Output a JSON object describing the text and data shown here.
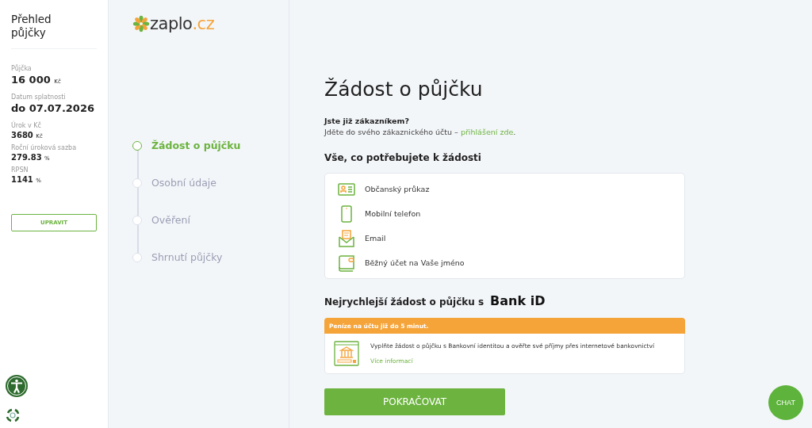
{
  "summary": {
    "title": "Přehled půjčky",
    "items": [
      {
        "kind": "large",
        "label": "Půjčka",
        "value": "16 000",
        "unit": "Kč"
      },
      {
        "kind": "large",
        "label": "Datum splatnosti",
        "value": "do 07.07.2026"
      },
      {
        "kind": "small",
        "label": "Úrok v Kč",
        "value": "3680",
        "unit": "Kč"
      },
      {
        "kind": "small",
        "label": "Roční úroková sazba",
        "value": "279.83",
        "unit": "%"
      },
      {
        "kind": "small",
        "label": "RPSN",
        "value": "1141",
        "unit": "%"
      }
    ],
    "edit_button": "UPRAVIT"
  },
  "logo": {
    "name": "zaplo",
    "domain": ".cz"
  },
  "steps": [
    {
      "label": "Žádost o půjčku",
      "selected": true
    },
    {
      "label": "Osobní údaje",
      "selected": false
    },
    {
      "label": "Ověření",
      "selected": false
    },
    {
      "label": "Shrnutí půjčky",
      "selected": false
    }
  ],
  "title": "Žádost o půjčku",
  "customer": {
    "question": "Jste již zákazníkem?",
    "text": "Jděte do svého zákaznického účtu – ",
    "link": "přihlášení zde",
    "after": "."
  },
  "requirements": {
    "heading": "Vše, co potřebujete k žádosti",
    "items": [
      {
        "kind": "id-card",
        "label": "Občanský průkaz"
      },
      {
        "kind": "phone",
        "label": "Mobilní telefon"
      },
      {
        "kind": "email",
        "label": "Email"
      },
      {
        "kind": "wallet",
        "label": "Běžný účet na Vaše jméno"
      }
    ]
  },
  "bankid": {
    "heading": "Nejrychlejší žádost o půjčku s",
    "brand": "Bank iD",
    "banner": "Peníze na účtu již do 5 minut.",
    "text": "Vyplňte žádost o půjčku s Bankovní identitou a ověřte své příjmy přes internetové bankovnictví",
    "link": "Více informací"
  },
  "continue_button": "POKRAČOVAT",
  "chat_button": "CHAT"
}
